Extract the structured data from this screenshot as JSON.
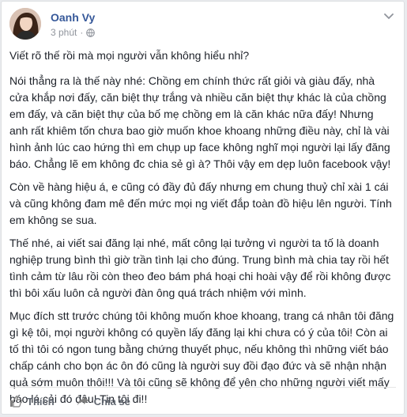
{
  "post": {
    "author": "Oanh Vy",
    "time": "3 phút",
    "separator": "·",
    "icons": {
      "privacy": "globe-icon",
      "menu": "chevron-down-icon",
      "like": "thumbs-up-icon",
      "share": "share-arrow-icon"
    },
    "paragraphs": [
      "Viết rõ thế rồi mà mọi người vẫn không hiểu nhỉ?",
      "Nói thẳng ra là thế này nhé: Chồng em chính thức rất giỏi và giàu đấy, nhà cửa khắp nơi đấy, căn biệt thự trắng và nhiều căn biệt thự khác là của chồng em đấy, và căn biệt thự của bố mẹ chồng em là căn khác nữa đấy! Nhưng anh rất khiêm tốn chưa bao giờ muốn khoe khoang những điều này, chỉ là vài hình ảnh lúc cao hứng thì em chụp up face không nghĩ mọi người lại lấy đăng báo. Chẳng lẽ em không đc chia sẻ gì à? Thôi vậy em dẹp luôn facebook vậy!",
      "Còn về hàng hiệu á, e cũng có đầy đủ đấy nhưng em chung thuỷ chỉ xài 1 cái và cũng không đam mê đến mức mọi ng viết đắp toàn đồ hiệu lên người. Tính em không se sua.",
      "Thế nhé, ai viết sai đăng lại nhé, mất công lại tưởng vì người ta tố là doanh nghiệp trung bình thì giờ trần tình lại cho đúng. Trung bình mà chia tay rồi hết tình cảm từ lâu rồi còn theo đeo bám phá hoại chi hoài vậy để rồi không được thì bôi xấu luôn cả người đàn ông quá trách nhiệm với mình.",
      "Mục đích stt trước chúng tôi không muốn khoe khoang, trang cá nhân tôi đăng gì kệ tôi, mọi người không có quyền lấy đăng lại khi chưa có ý của tôi! Còn ai tố thì tôi có ngon tung bằng chứng thuyết phục, nếu không thì những viết báo chấp cánh cho bọn ác ôn đó cũng là người suy đồi đạo đức và sẽ nhận nhận quả sớm muộn thôi!!! Và tôi cũng sẽ không để yên cho những người viết mấy báo lá cải đó đâu! Tin tôi đi!!"
    ]
  },
  "actions": {
    "like_label": "Thích",
    "share_label": "Chia sẻ"
  }
}
